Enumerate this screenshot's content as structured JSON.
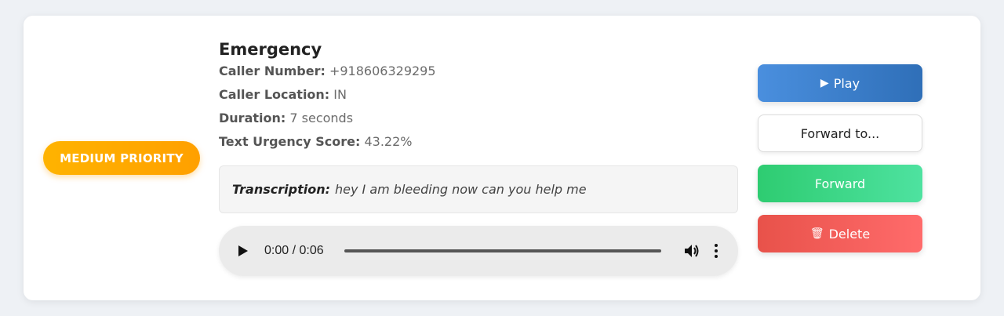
{
  "card": {
    "priority_label": "MEDIUM PRIORITY",
    "title": "Emergency",
    "fields": [
      {
        "label": "Caller Number:",
        "value": "+918606329295"
      },
      {
        "label": "Caller Location:",
        "value": "IN"
      },
      {
        "label": "Duration:",
        "value": "7 seconds"
      },
      {
        "label": "Text Urgency Score:",
        "value": "43.22%"
      }
    ],
    "transcription": {
      "label": "Transcription:",
      "text": "hey I am bleeding now can you help me"
    },
    "audio": {
      "time": "0:00 / 0:06",
      "progress": 0
    }
  },
  "actions": {
    "play": {
      "icon": "▶",
      "label": "Play"
    },
    "forward_select": {
      "label": "Forward to..."
    },
    "forward": {
      "label": "Forward"
    },
    "delete": {
      "icon": "🗑",
      "label": "Delete"
    }
  },
  "colors": {
    "priority": "#ffb300",
    "play": "#3a7fcf",
    "forward": "#35d07a",
    "delete": "#ef5a52",
    "background": "#eef1f5"
  }
}
